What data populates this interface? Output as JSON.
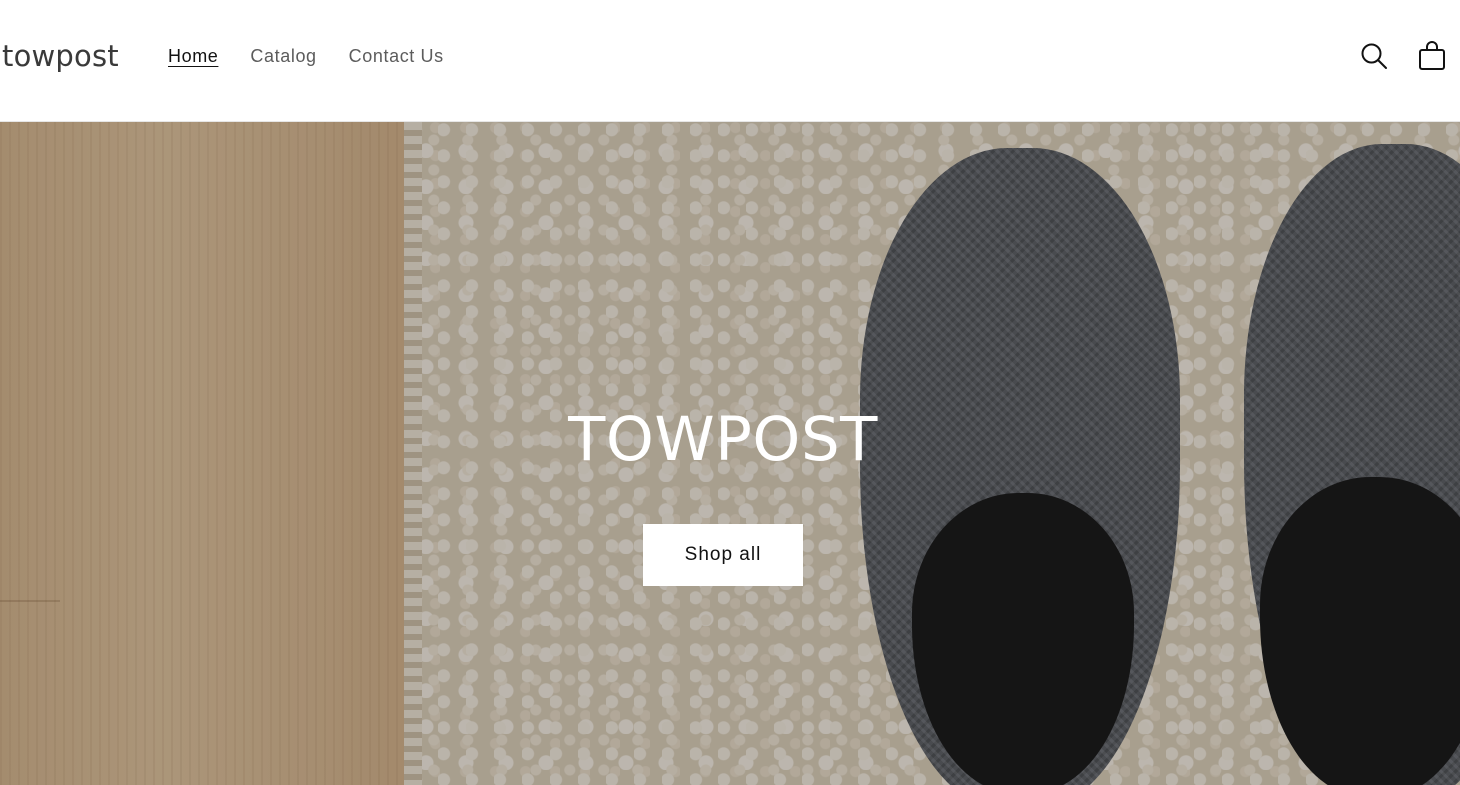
{
  "header": {
    "logo": "towpost",
    "nav": [
      {
        "label": "Home",
        "active": true
      },
      {
        "label": "Catalog",
        "active": false
      },
      {
        "label": "Contact Us",
        "active": false
      }
    ],
    "icons": {
      "search": "search-icon",
      "cart": "cart-icon"
    }
  },
  "hero": {
    "title": "TOWPOST",
    "button_label": "Shop all",
    "image": "slippers-on-rug"
  },
  "colors": {
    "text": "#121212",
    "nav_inactive": "#5c5c5c",
    "button_bg": "#ffffff",
    "hero_text": "#ffffff"
  }
}
